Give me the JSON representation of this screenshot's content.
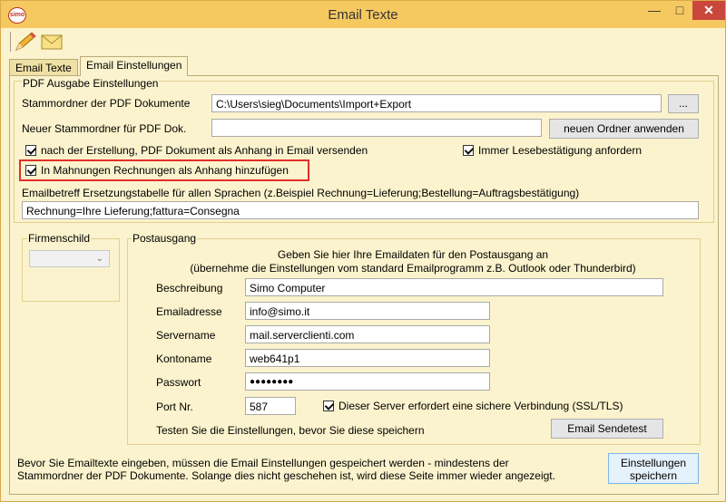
{
  "window": {
    "title": "Email Texte",
    "app_badge": "simo",
    "minimize": "—",
    "maximize": "□",
    "close": "✕"
  },
  "tabs": [
    {
      "label": "Email Texte"
    },
    {
      "label": "Email Einstellungen"
    }
  ],
  "pdf": {
    "group_title": "PDF Ausgabe Einstellungen",
    "root_label": "Stammordner der PDF Dokumente",
    "root_value": "C:\\Users\\sieg\\Documents\\Import+Export",
    "browse_label": "...",
    "new_root_label": "Neuer Stammordner für PDF Dok.",
    "new_root_value": "",
    "apply_folder_label": "neuen Ordner anwenden",
    "attach_label": "nach der Erstellung,  PDF Dokument als Anhang in Email versenden",
    "read_receipt_label": "Immer Lesebestätigung anfordern",
    "reminders_label": "In Mahnungen Rechnungen als Anhang hinzufügen",
    "subject_table_label": "Emailbetreff Ersetzungstabelle für allen Sprachen (z.Beispiel Rechnung=Lieferung;Bestellung=Auftragsbestätigung)",
    "subject_table_value": "Rechnung=Ihre Lieferung;fattura=Consegna"
  },
  "firmenschild": {
    "title": "Firmenschild"
  },
  "postausgang": {
    "title": "Postausgang",
    "intro1": "Geben Sie hier Ihre Emaildaten für den Postausgang an",
    "intro2": "(übernehme die Einstellungen vom standard Emailprogramm z.B. Outlook oder Thunderbird)",
    "description_label": "Beschreibung",
    "description_value": "Simo Computer",
    "email_label": "Emailadresse",
    "email_value": "info@simo.it",
    "server_label": "Servername",
    "server_value": "mail.serverclienti.com",
    "account_label": "Kontoname",
    "account_value": "web641p1",
    "password_label": "Passwort",
    "password_value": "●●●●●●●●",
    "port_label": "Port Nr.",
    "port_value": "587",
    "ssl_label": "Dieser Server erfordert eine sichere Verbindung (SSL/TLS)",
    "test_hint": "Testen Sie die Einstellungen, bevor Sie diese speichern",
    "test_button": "Email Sendetest"
  },
  "footer": {
    "note1": "Bevor Sie Emailtexte eingeben, müssen die Email Einstellungen gespeichert werden - mindestens der",
    "note2": "Stammordner der PDF Dokumente. Solange dies nicht geschehen ist, wird diese Seite immer wieder angezeigt.",
    "save_line1": "Einstellungen",
    "save_line2": "speichern"
  }
}
